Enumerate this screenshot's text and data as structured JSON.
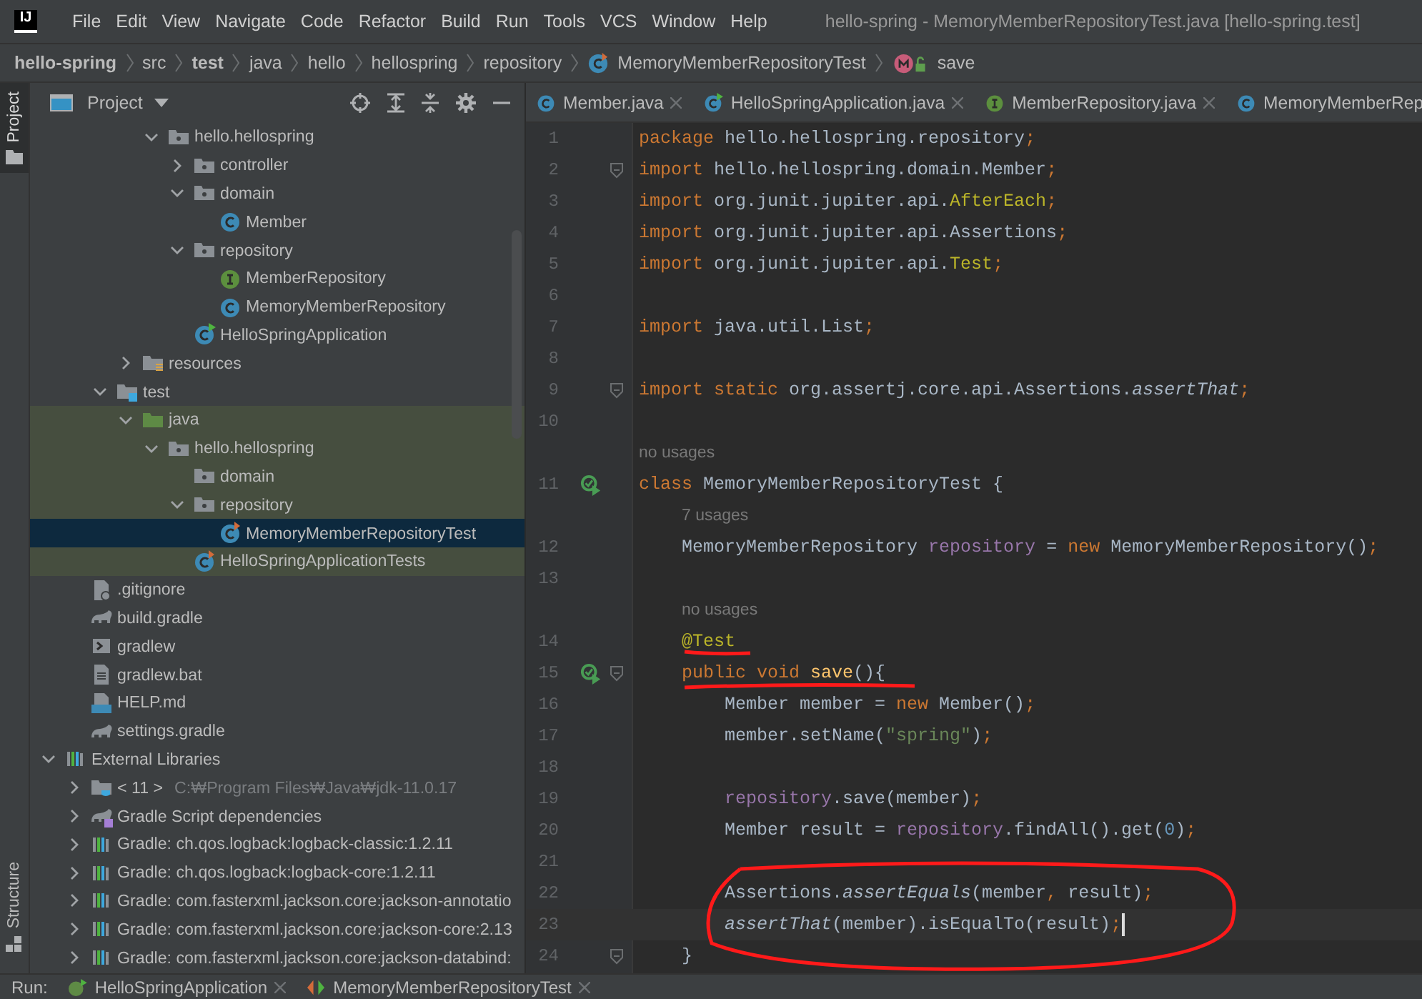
{
  "app": {
    "logo": "IJ",
    "title": "hello-spring - MemoryMemberRepositoryTest.java [hello-spring.test]"
  },
  "menu": [
    "File",
    "Edit",
    "View",
    "Navigate",
    "Code",
    "Refactor",
    "Build",
    "Run",
    "Tools",
    "VCS",
    "Window",
    "Help"
  ],
  "breadcrumb": [
    {
      "label": "hello-spring",
      "kind": "module"
    },
    {
      "label": "src",
      "kind": "dir"
    },
    {
      "label": "test",
      "kind": "module"
    },
    {
      "label": "java",
      "kind": "dir"
    },
    {
      "label": "hello",
      "kind": "dir"
    },
    {
      "label": "hellospring",
      "kind": "dir"
    },
    {
      "label": "repository",
      "kind": "dir"
    },
    {
      "label": "MemoryMemberRepositoryTest",
      "kind": "class"
    },
    {
      "label": "save",
      "kind": "method"
    }
  ],
  "side_tabs": [
    {
      "label": "Project",
      "selected": true
    },
    {
      "label": "Structure",
      "selected": false
    }
  ],
  "project_panel": {
    "title": "Project",
    "tree": [
      {
        "children": [
          {
            "children": [
              {
                "children": [
                  {
                    "children": [
                      {
                        "label": "hello.hellospring",
                        "kind": "package",
                        "expanded": true,
                        "selected": false,
                        "highlighted": false,
                        "children": [
                          {
                            "label": "controller",
                            "kind": "package",
                            "expanded": false,
                            "selected": false,
                            "highlighted": false
                          },
                          {
                            "label": "domain",
                            "kind": "package",
                            "expanded": true,
                            "selected": false,
                            "highlighted": false,
                            "children": [
                              {
                                "label": "Member",
                                "kind": "class",
                                "selected": false,
                                "highlighted": false
                              }
                            ]
                          },
                          {
                            "label": "repository",
                            "kind": "package",
                            "expanded": true,
                            "selected": false,
                            "highlighted": false,
                            "children": [
                              {
                                "label": "MemberRepository",
                                "kind": "interface",
                                "selected": false,
                                "highlighted": false
                              },
                              {
                                "label": "MemoryMemberRepository",
                                "kind": "class",
                                "selected": false,
                                "highlighted": false
                              }
                            ]
                          },
                          {
                            "label": "HelloSpringApplication",
                            "kind": "spring-app",
                            "selected": false,
                            "highlighted": false
                          }
                        ]
                      }
                    ]
                  },
                  {
                    "label": "resources",
                    "kind": "resources",
                    "expanded": false,
                    "selected": false,
                    "highlighted": false
                  }
                ]
              },
              {
                "label": "test",
                "kind": "test-root",
                "expanded": true,
                "selected": false,
                "highlighted": false,
                "children": [
                  {
                    "label": "java",
                    "kind": "java-src",
                    "expanded": true,
                    "selected": false,
                    "highlighted": true,
                    "children": [
                      {
                        "label": "hello.hellospring",
                        "kind": "package",
                        "expanded": true,
                        "selected": false,
                        "highlighted": true,
                        "children": [
                          {
                            "label": "domain",
                            "kind": "package",
                            "selected": false,
                            "highlighted": true
                          },
                          {
                            "label": "repository",
                            "kind": "package",
                            "expanded": true,
                            "selected": false,
                            "highlighted": true,
                            "children": [
                              {
                                "label": "MemoryMemberRepositoryTest",
                                "kind": "test-class",
                                "selected": true
                              }
                            ]
                          },
                          {
                            "label": "HelloSpringApplicationTests",
                            "kind": "test-class",
                            "selected": false,
                            "highlighted": true
                          }
                        ]
                      }
                    ]
                  }
                ]
              }
            ]
          },
          {
            "label": ".gitignore",
            "kind": "ignore-file",
            "selected": false,
            "highlighted": false
          },
          {
            "label": "build.gradle",
            "kind": "gradle",
            "selected": false,
            "highlighted": false
          },
          {
            "label": "gradlew",
            "kind": "script",
            "selected": false,
            "highlighted": false
          },
          {
            "label": "gradlew.bat",
            "kind": "text",
            "selected": false,
            "highlighted": false
          },
          {
            "label": "HELP.md",
            "kind": "markdown",
            "selected": false,
            "highlighted": false
          },
          {
            "label": "settings.gradle",
            "kind": "gradle",
            "selected": false,
            "highlighted": false
          }
        ]
      },
      {
        "label": "External Libraries",
        "kind": "libraries",
        "expanded": true,
        "selected": false,
        "highlighted": false,
        "children": [
          {
            "label": "< 11 >",
            "note": "C:₩Program Files₩Java₩jdk-11.0.17",
            "kind": "jdk",
            "expanded": false,
            "selected": false,
            "highlighted": false
          },
          {
            "label": "Gradle Script dependencies",
            "kind": "gradle-deps",
            "expanded": false,
            "selected": false,
            "highlighted": false
          },
          {
            "label": "Gradle: ch.qos.logback:logback-classic:1.2.11",
            "kind": "library",
            "expanded": false,
            "selected": false,
            "highlighted": false
          },
          {
            "label": "Gradle: ch.qos.logback:logback-core:1.2.11",
            "kind": "library",
            "expanded": false,
            "selected": false,
            "highlighted": false
          },
          {
            "label": "Gradle: com.fasterxml.jackson.core:jackson-annotatio",
            "kind": "library",
            "expanded": false,
            "selected": false,
            "highlighted": false
          },
          {
            "label": "Gradle: com.fasterxml.jackson.core:jackson-core:2.13",
            "kind": "library",
            "expanded": false,
            "selected": false,
            "highlighted": false
          },
          {
            "label": "Gradle: com.fasterxml.jackson.core:jackson-databind:",
            "kind": "library",
            "expanded": false,
            "selected": false,
            "highlighted": false
          }
        ]
      }
    ]
  },
  "editor_tabs": [
    {
      "label": "Member.java",
      "kind": "class",
      "selected": false
    },
    {
      "label": "HelloSpringApplication.java",
      "kind": "spring-app",
      "selected": false
    },
    {
      "label": "MemberRepository.java",
      "kind": "interface",
      "selected": false
    },
    {
      "label": "MemoryMemberRep",
      "kind": "class",
      "selected": false
    }
  ],
  "code": [
    {
      "number": "1",
      "run": false,
      "fold": false,
      "current": false,
      "tokens": [
        {
          "text": "package",
          "kind": "kw"
        },
        {
          "text": " hello.hellospring.repository",
          "kind": "id"
        },
        {
          "text": ";",
          "kind": "kw"
        }
      ]
    },
    {
      "number": "2",
      "run": false,
      "fold": true,
      "current": false,
      "tokens": [
        {
          "text": "import",
          "kind": "kw"
        },
        {
          "text": " hello.hellospring.domain.Member",
          "kind": "id"
        },
        {
          "text": ";",
          "kind": "kw"
        }
      ]
    },
    {
      "number": "3",
      "run": false,
      "fold": false,
      "current": false,
      "tokens": [
        {
          "text": "import",
          "kind": "kw"
        },
        {
          "text": " org.junit.jupiter.api.",
          "kind": "id"
        },
        {
          "text": "AfterEach",
          "kind": "ann"
        },
        {
          "text": ";",
          "kind": "kw"
        }
      ]
    },
    {
      "number": "4",
      "run": false,
      "fold": false,
      "current": false,
      "tokens": [
        {
          "text": "import",
          "kind": "kw"
        },
        {
          "text": " org.junit.jupiter.api.Assertions",
          "kind": "id"
        },
        {
          "text": ";",
          "kind": "kw"
        }
      ]
    },
    {
      "number": "5",
      "run": false,
      "fold": false,
      "current": false,
      "tokens": [
        {
          "text": "import",
          "kind": "kw"
        },
        {
          "text": " org.junit.jupiter.api.",
          "kind": "id"
        },
        {
          "text": "Test",
          "kind": "ann"
        },
        {
          "text": ";",
          "kind": "kw"
        }
      ]
    },
    {
      "number": "6",
      "run": false,
      "fold": false,
      "current": false
    },
    {
      "number": "7",
      "run": false,
      "fold": false,
      "current": false,
      "tokens": [
        {
          "text": "import",
          "kind": "kw"
        },
        {
          "text": " java.util.List",
          "kind": "id"
        },
        {
          "text": ";",
          "kind": "kw"
        }
      ]
    },
    {
      "number": "8",
      "run": false,
      "fold": false,
      "current": false
    },
    {
      "number": "9",
      "run": false,
      "fold": true,
      "current": false,
      "tokens": [
        {
          "text": "import static",
          "kind": "kw"
        },
        {
          "text": " org.assertj.core.api.Assertions.",
          "kind": "id"
        },
        {
          "text": "assertThat",
          "kind": "static"
        },
        {
          "text": ";",
          "kind": "kw"
        }
      ]
    },
    {
      "number": "10",
      "run": false,
      "fold": false,
      "current": false
    },
    {
      "number": "11",
      "hint": "no usages",
      "run": true,
      "fold": false,
      "current": false,
      "tokens": [
        {
          "text": "class",
          "kind": "kw"
        },
        {
          "text": " MemoryMemberRepositoryTest {",
          "kind": "id"
        }
      ]
    },
    {
      "number": "12",
      "hint": "7 usages",
      "run": false,
      "fold": false,
      "current": false,
      "tokens": [
        {
          "text": "    MemoryMemberRepository ",
          "kind": "id"
        },
        {
          "text": "repository",
          "kind": "field"
        },
        {
          "text": " = ",
          "kind": "id"
        },
        {
          "text": "new",
          "kind": "kw"
        },
        {
          "text": " MemoryMemberRepository()",
          "kind": "id"
        },
        {
          "text": ";",
          "kind": "kw"
        }
      ]
    },
    {
      "number": "13",
      "run": false,
      "fold": false,
      "current": false
    },
    {
      "number": "14",
      "hint": "no usages",
      "run": false,
      "fold": false,
      "current": false,
      "tokens": [
        {
          "text": "    @Test",
          "kind": "ann"
        }
      ]
    },
    {
      "number": "15",
      "run": true,
      "fold": true,
      "current": false,
      "tokens": [
        {
          "text": "    public void",
          "kind": "kw"
        },
        {
          "text": " save",
          "kind": "decl"
        },
        {
          "text": "(){",
          "kind": "id"
        }
      ]
    },
    {
      "number": "16",
      "run": false,
      "fold": false,
      "current": false,
      "tokens": [
        {
          "text": "        Member member = ",
          "kind": "id"
        },
        {
          "text": "new",
          "kind": "kw"
        },
        {
          "text": " Member()",
          "kind": "id"
        },
        {
          "text": ";",
          "kind": "kw"
        }
      ]
    },
    {
      "number": "17",
      "run": false,
      "fold": false,
      "current": false,
      "tokens": [
        {
          "text": "        member.setName(",
          "kind": "id"
        },
        {
          "text": "\"spring\"",
          "kind": "str"
        },
        {
          "text": ")",
          "kind": "id"
        },
        {
          "text": ";",
          "kind": "kw"
        }
      ]
    },
    {
      "number": "18",
      "run": false,
      "fold": false,
      "current": false
    },
    {
      "number": "19",
      "run": false,
      "fold": false,
      "current": false,
      "tokens": [
        {
          "text": "        repository",
          "kind": "field"
        },
        {
          "text": ".save(member)",
          "kind": "id"
        },
        {
          "text": ";",
          "kind": "kw"
        }
      ]
    },
    {
      "number": "20",
      "run": false,
      "fold": false,
      "current": false,
      "tokens": [
        {
          "text": "        Member result = ",
          "kind": "id"
        },
        {
          "text": "repository",
          "kind": "field"
        },
        {
          "text": ".findAll().get(",
          "kind": "id"
        },
        {
          "text": "0",
          "kind": "num"
        },
        {
          "text": ")",
          "kind": "id"
        },
        {
          "text": ";",
          "kind": "kw"
        }
      ]
    },
    {
      "number": "21",
      "run": false,
      "fold": false,
      "current": false
    },
    {
      "number": "22",
      "run": false,
      "fold": false,
      "current": false,
      "tokens": [
        {
          "text": "        Assertions.",
          "kind": "id"
        },
        {
          "text": "assertEquals",
          "kind": "static"
        },
        {
          "text": "(member",
          "kind": "id"
        },
        {
          "text": ",",
          "kind": "kw"
        },
        {
          "text": " result)",
          "kind": "id"
        },
        {
          "text": ";",
          "kind": "kw"
        }
      ]
    },
    {
      "number": "23",
      "run": false,
      "fold": false,
      "current": true,
      "tokens": [
        {
          "text": "        assertThat",
          "kind": "static"
        },
        {
          "text": "(member).isEqualTo(result)",
          "kind": "id"
        },
        {
          "text": ";",
          "kind": "kw"
        }
      ]
    },
    {
      "number": "24",
      "run": false,
      "fold": true,
      "current": false,
      "tokens": [
        {
          "text": "    }",
          "kind": "id"
        }
      ]
    }
  ],
  "run_bar": {
    "label": "Run:",
    "tabs": [
      {
        "label": "HelloSpringApplication",
        "kind": "spring-app",
        "selected": false
      },
      {
        "label": "MemoryMemberRepositoryTest",
        "kind": "test-run",
        "selected": false
      }
    ]
  }
}
